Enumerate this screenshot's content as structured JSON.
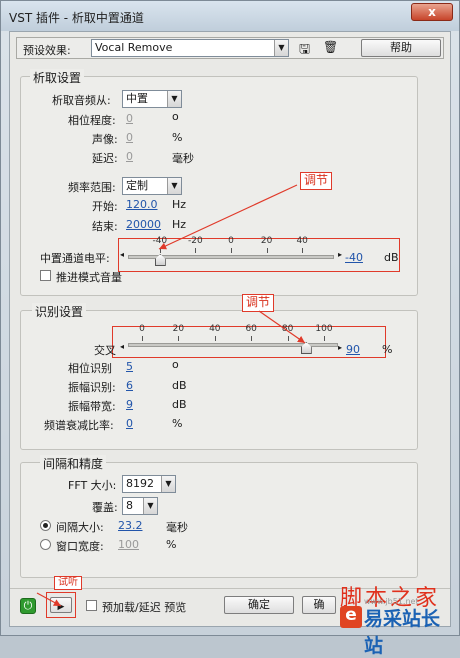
{
  "window": {
    "title": "VST 插件 - 析取中置通道",
    "close": "x"
  },
  "preset": {
    "label": "预设效果:",
    "value": "Vocal Remove",
    "help": "帮助"
  },
  "extract": {
    "title": "析取设置",
    "freq_from_label": "析取音频从:",
    "freq_from_value": "中置",
    "phase_label": "相位程度:",
    "phase_value": "0",
    "phase_unit": "o",
    "pan_label": "声像:",
    "pan_value": "0",
    "pan_unit": "%",
    "delay_label": "延迟:",
    "delay_value": "0",
    "delay_unit": "毫秒",
    "range_label": "频率范围:",
    "range_value": "定制",
    "start_label": "开始:",
    "start_value": "120.0",
    "start_unit": "Hz",
    "end_label": "结束:",
    "end_value": "20000",
    "end_unit": "Hz",
    "level_label": "中置通道电平:",
    "level_value": "-40",
    "level_unit": "dB",
    "level_ticks": [
      "-40",
      "-20",
      "0",
      "20",
      "40"
    ],
    "level_slider": -40,
    "boost_label": "推进模式音量",
    "annotation": "调节"
  },
  "discrim": {
    "title": "识别设置",
    "cross_label": "交叉",
    "cross_value": "90",
    "cross_unit": "%",
    "cross_ticks": [
      "0",
      "20",
      "40",
      "60",
      "80",
      "100"
    ],
    "cross_slider": 90,
    "phase_label": "相位识别",
    "phase_value": "5",
    "phase_unit": "o",
    "amp_label": "振幅识别:",
    "amp_value": "6",
    "amp_unit": "dB",
    "bw_label": "振幅带宽:",
    "bw_value": "9",
    "bw_unit": "dB",
    "spec_label": "频谱衰减比率:",
    "spec_value": "0",
    "spec_unit": "%",
    "annotation": "调节"
  },
  "interval": {
    "title": "间隔和精度",
    "fft_label": "FFT 大小:",
    "fft_value": "8192",
    "overlap_label": "覆盖:",
    "overlap_value": "8",
    "interval_label": "间隔大小:",
    "interval_value": "23.2",
    "interval_unit": "毫秒",
    "window_label": "窗口宽度:",
    "window_value": "100",
    "window_unit": "%"
  },
  "bottom": {
    "preview_label": "预加载/延迟 预览",
    "ok": "确定",
    "cancel": "确",
    "annotation": "试听"
  },
  "watermark": {
    "script": "脚本之家",
    "site": "易采站长站",
    "url": "www.jb51.net"
  },
  "colors": {
    "annotation": "#e03a2a",
    "value": "#2255aa",
    "power": "#2f9a2f"
  }
}
